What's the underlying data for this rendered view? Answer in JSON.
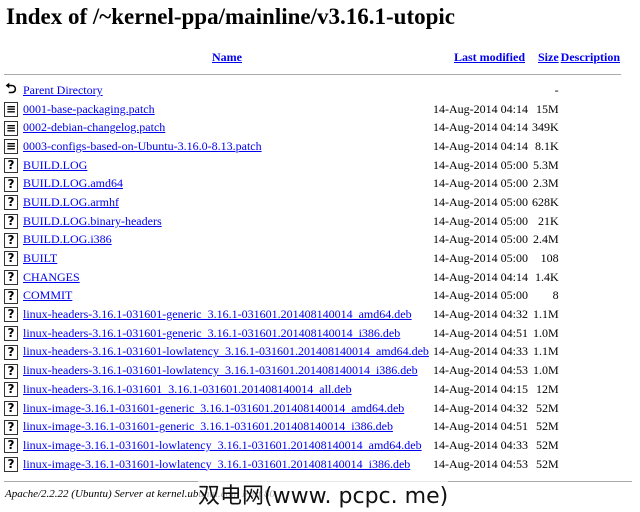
{
  "title": "Index of /~kernel-ppa/mainline/v3.16.1-utopic",
  "columns": {
    "name": "Name",
    "modified": "Last modified",
    "size": "Size",
    "description": "Description"
  },
  "rows": [
    {
      "icon": "back-icon",
      "name": "Parent Directory",
      "modified": "",
      "size": "-"
    },
    {
      "icon": "text-file-icon",
      "name": "0001-base-packaging.patch",
      "modified": "14-Aug-2014 04:14",
      "size": "15M"
    },
    {
      "icon": "text-file-icon",
      "name": "0002-debian-changelog.patch",
      "modified": "14-Aug-2014 04:14",
      "size": "349K"
    },
    {
      "icon": "text-file-icon",
      "name": "0003-configs-based-on-Ubuntu-3.16.0-8.13.patch",
      "modified": "14-Aug-2014 04:14",
      "size": "8.1K"
    },
    {
      "icon": "unknown-file-icon",
      "name": "BUILD.LOG",
      "modified": "14-Aug-2014 05:00",
      "size": "5.3M"
    },
    {
      "icon": "unknown-file-icon",
      "name": "BUILD.LOG.amd64",
      "modified": "14-Aug-2014 05:00",
      "size": "2.3M"
    },
    {
      "icon": "unknown-file-icon",
      "name": "BUILD.LOG.armhf",
      "modified": "14-Aug-2014 05:00",
      "size": "628K"
    },
    {
      "icon": "unknown-file-icon",
      "name": "BUILD.LOG.binary-headers",
      "modified": "14-Aug-2014 05:00",
      "size": "21K"
    },
    {
      "icon": "unknown-file-icon",
      "name": "BUILD.LOG.i386",
      "modified": "14-Aug-2014 05:00",
      "size": "2.4M"
    },
    {
      "icon": "unknown-file-icon",
      "name": "BUILT",
      "modified": "14-Aug-2014 05:00",
      "size": "108"
    },
    {
      "icon": "unknown-file-icon",
      "name": "CHANGES",
      "modified": "14-Aug-2014 04:14",
      "size": "1.4K"
    },
    {
      "icon": "unknown-file-icon",
      "name": "COMMIT",
      "modified": "14-Aug-2014 05:00",
      "size": "8"
    },
    {
      "icon": "unknown-file-icon",
      "name": "linux-headers-3.16.1-031601-generic_3.16.1-031601.201408140014_amd64.deb",
      "modified": "14-Aug-2014 04:32",
      "size": "1.1M"
    },
    {
      "icon": "unknown-file-icon",
      "name": "linux-headers-3.16.1-031601-generic_3.16.1-031601.201408140014_i386.deb",
      "modified": "14-Aug-2014 04:51",
      "size": "1.0M"
    },
    {
      "icon": "unknown-file-icon",
      "name": "linux-headers-3.16.1-031601-lowlatency_3.16.1-031601.201408140014_amd64.deb",
      "modified": "14-Aug-2014 04:33",
      "size": "1.1M"
    },
    {
      "icon": "unknown-file-icon",
      "name": "linux-headers-3.16.1-031601-lowlatency_3.16.1-031601.201408140014_i386.deb",
      "modified": "14-Aug-2014 04:53",
      "size": "1.0M"
    },
    {
      "icon": "unknown-file-icon",
      "name": "linux-headers-3.16.1-031601_3.16.1-031601.201408140014_all.deb",
      "modified": "14-Aug-2014 04:15",
      "size": "12M"
    },
    {
      "icon": "unknown-file-icon",
      "name": "linux-image-3.16.1-031601-generic_3.16.1-031601.201408140014_amd64.deb",
      "modified": "14-Aug-2014 04:32",
      "size": "52M"
    },
    {
      "icon": "unknown-file-icon",
      "name": "linux-image-3.16.1-031601-generic_3.16.1-031601.201408140014_i386.deb",
      "modified": "14-Aug-2014 04:51",
      "size": "52M"
    },
    {
      "icon": "unknown-file-icon",
      "name": "linux-image-3.16.1-031601-lowlatency_3.16.1-031601.201408140014_amd64.deb",
      "modified": "14-Aug-2014 04:33",
      "size": "52M"
    },
    {
      "icon": "unknown-file-icon",
      "name": "linux-image-3.16.1-031601-lowlatency_3.16.1-031601.201408140014_i386.deb",
      "modified": "14-Aug-2014 04:53",
      "size": "52M"
    }
  ],
  "footer": "Apache/2.2.22 (Ubuntu) Server at kernel.ubuntu.com Port 80",
  "watermark": "双电网(www. pcpc. me)"
}
